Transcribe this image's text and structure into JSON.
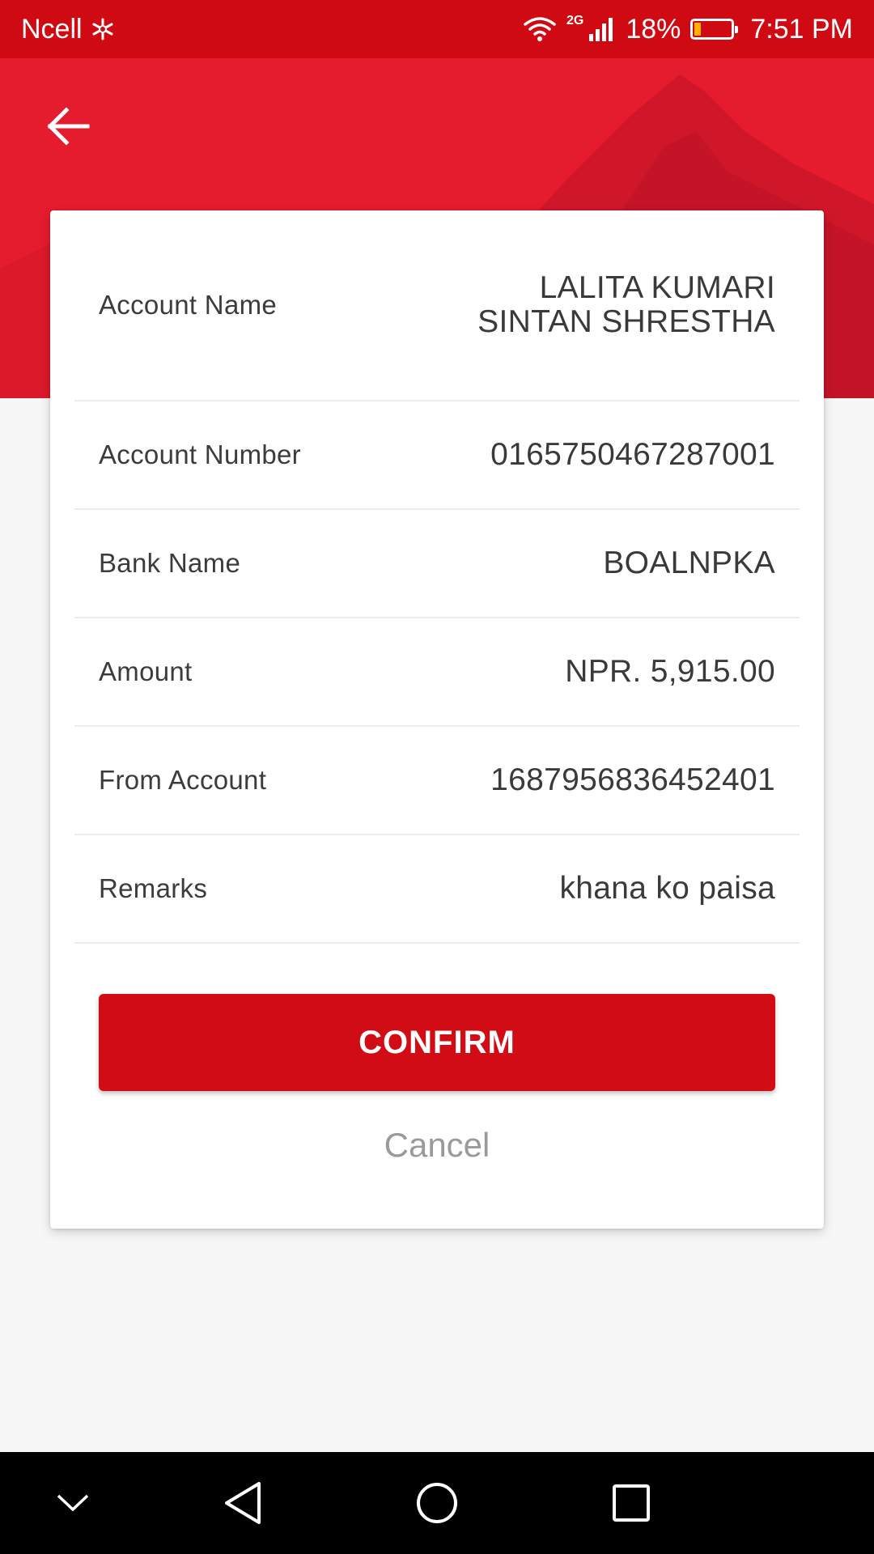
{
  "status_bar": {
    "carrier": "Ncell",
    "network_type": "2G",
    "battery": "18%",
    "battery_level": 0.18,
    "time": "7:51 PM",
    "icons": [
      "carrier-logo-icon",
      "wifi-icon",
      "signal-icon",
      "battery-icon"
    ]
  },
  "header": {
    "back_icon": "arrow-left-icon"
  },
  "details": [
    {
      "label": "Account Name",
      "value_lines": [
        "LALITA KUMARI",
        "SINTAN SHRESTHA"
      ]
    },
    {
      "label": "Account Number",
      "value": "0165750467287001"
    },
    {
      "label": "Bank Name",
      "value": "BOALNPKA"
    },
    {
      "label": "Amount",
      "value": "NPR. 5,915.00"
    },
    {
      "label": "From Account",
      "value": "1687956836452401"
    },
    {
      "label": "Remarks",
      "value": "khana ko paisa"
    }
  ],
  "actions": {
    "confirm_label": "CONFIRM",
    "cancel_label": "Cancel"
  },
  "nav_bar": {
    "icons": [
      "chevron-down-icon",
      "back-triangle-icon",
      "home-circle-icon",
      "recents-square-icon"
    ]
  },
  "colors": {
    "status_bar": "#cf0a13",
    "header": "#e51c2e",
    "confirm_button": "#d10c14",
    "background": "#f7f7f7"
  }
}
